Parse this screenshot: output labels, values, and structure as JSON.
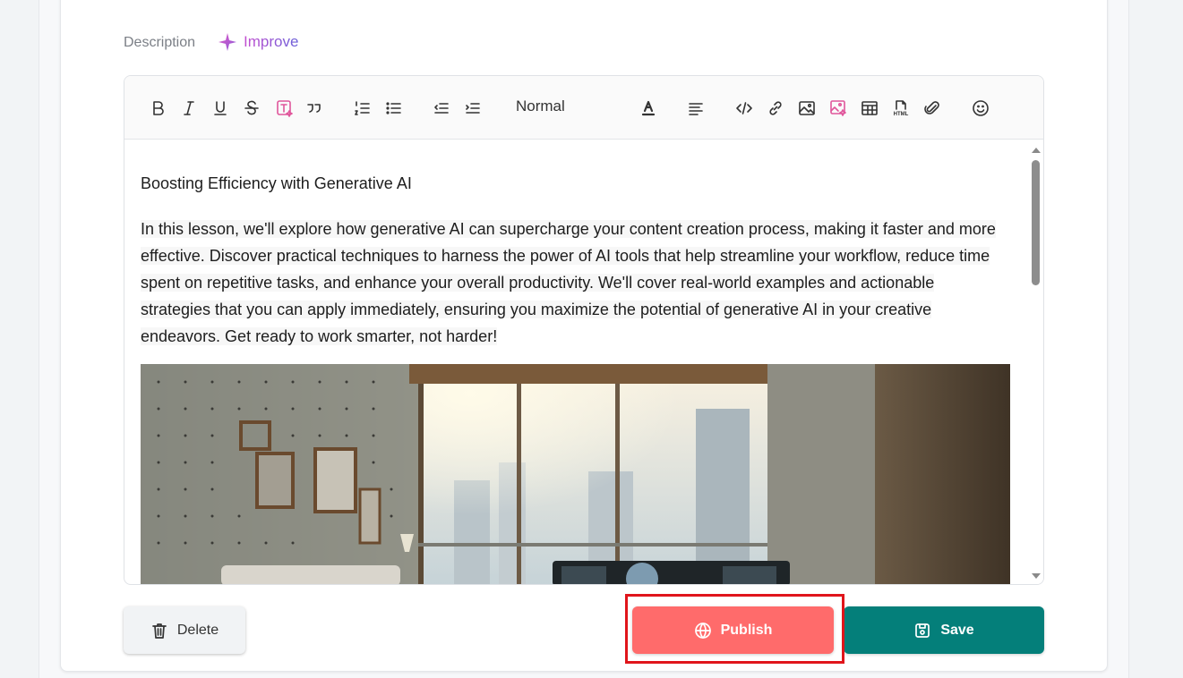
{
  "description": {
    "label": "Description",
    "improve_label": "Improve"
  },
  "toolbar": {
    "format_select": "Normal",
    "icons": [
      "bold-icon",
      "italic-icon",
      "underline-icon",
      "strikethrough-icon",
      "ai-text-icon",
      "blockquote-icon",
      "ordered-list-icon",
      "bullet-list-icon",
      "outdent-icon",
      "indent-icon",
      "text-color-icon",
      "align-icon",
      "code-icon",
      "link-icon",
      "image-icon",
      "ai-image-icon",
      "table-icon",
      "html-icon",
      "attachment-icon",
      "emoji-icon"
    ],
    "html_badge": "HTML"
  },
  "content": {
    "heading": "Boosting Efficiency with Generative AI",
    "paragraph": "In this lesson, we'll explore how generative AI can supercharge your content creation process, making it faster and more effective. Discover practical techniques to harness the power of AI tools that help streamline your workflow, reduce time spent on repetitive tasks, and enhance your overall productivity. We'll cover real-world examples and actionable strategies that you can apply immediately, ensuring you maximize the potential of generative AI in your creative endeavors. Get ready to work smarter, not harder!"
  },
  "actions": {
    "delete_label": "Delete",
    "publish_label": "Publish",
    "save_label": "Save"
  },
  "colors": {
    "publish": "#ff6b6b",
    "save": "#047f7a",
    "highlight": "#e0151b",
    "accent_pink": "#e0569b"
  }
}
